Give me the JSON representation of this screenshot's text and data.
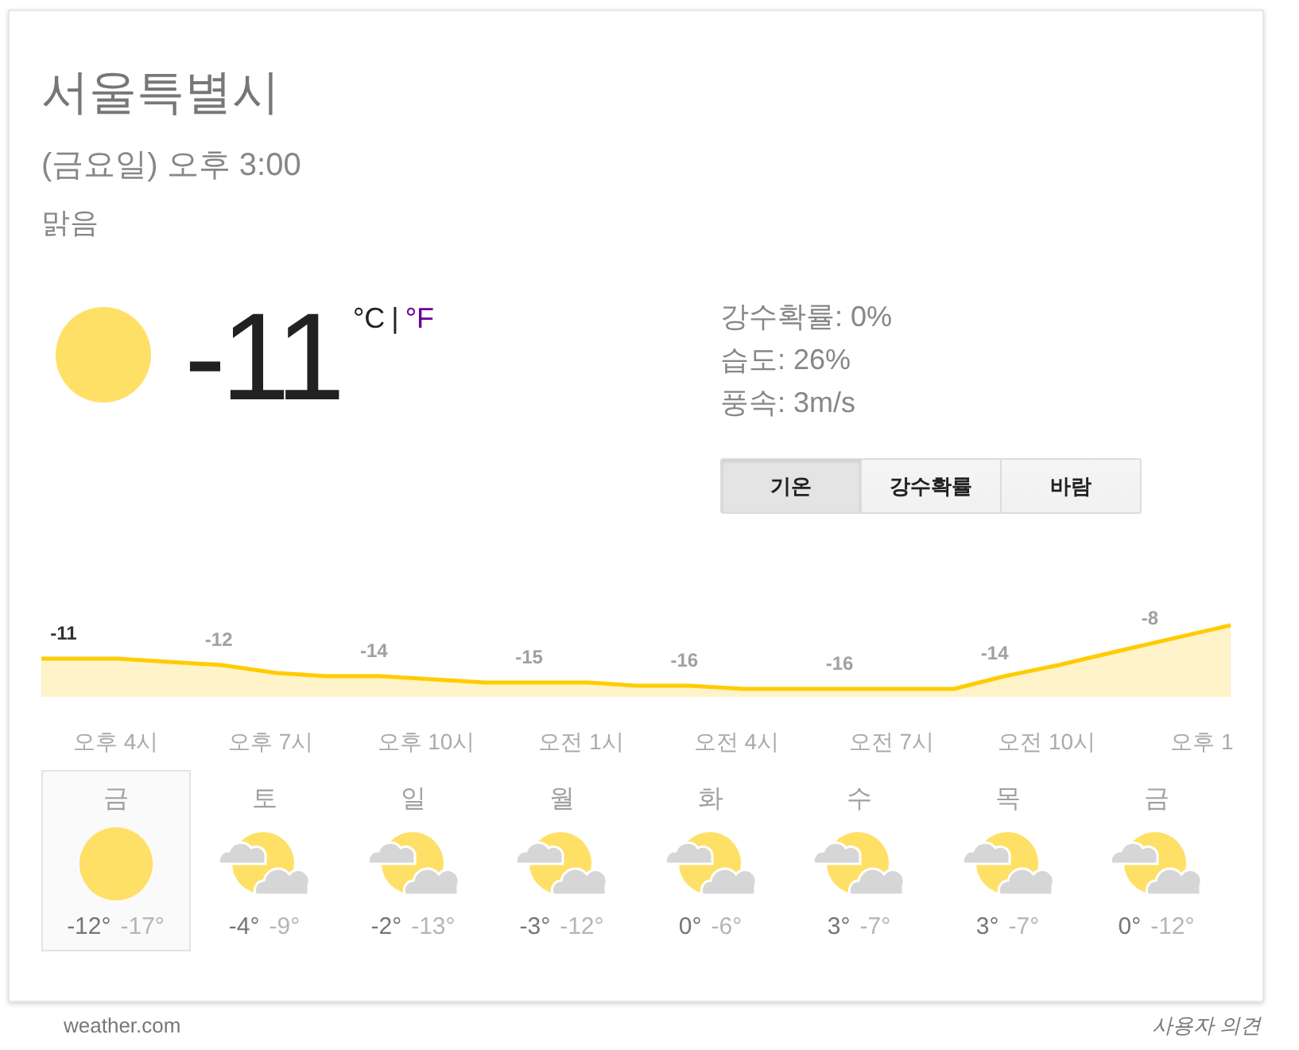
{
  "location": {
    "title": "서울특별시",
    "datetime": "(금요일) 오후 3:00",
    "condition": "맑음"
  },
  "current": {
    "kind": "sunny",
    "temperature": "-11",
    "units": [
      {
        "label": "°C",
        "selected": true
      },
      {
        "label": "°F",
        "selected": false
      }
    ],
    "unit_separator": "|",
    "details": [
      "강수확률: 0%",
      "습도: 26%",
      "풍속: 3m/s"
    ]
  },
  "tabs": [
    {
      "label": "기온",
      "selected": true
    },
    {
      "label": "강수확률",
      "selected": false
    },
    {
      "label": "바람",
      "selected": false
    }
  ],
  "hourly": {
    "first_label_current": true,
    "value_labels": [
      "-11",
      "-12",
      "-14",
      "-15",
      "-16",
      "-16",
      "-14",
      "-8"
    ],
    "hour_labels": [
      "오후 4시",
      "오후 7시",
      "오후 10시",
      "오전 1시",
      "오전 4시",
      "오전 7시",
      "오전 10시",
      "오후 1"
    ]
  },
  "days": [
    {
      "day": "금",
      "kind": "sunny",
      "high": "-12°",
      "low": "-17°",
      "selected": true
    },
    {
      "day": "토",
      "kind": "partly_cloudy",
      "high": "-4°",
      "low": "-9°",
      "selected": false
    },
    {
      "day": "일",
      "kind": "partly_cloudy",
      "high": "-2°",
      "low": "-13°",
      "selected": false
    },
    {
      "day": "월",
      "kind": "partly_cloudy",
      "high": "-3°",
      "low": "-12°",
      "selected": false
    },
    {
      "day": "화",
      "kind": "partly_cloudy",
      "high": "0°",
      "low": "-6°",
      "selected": false
    },
    {
      "day": "수",
      "kind": "partly_cloudy",
      "high": "3°",
      "low": "-7°",
      "selected": false
    },
    {
      "day": "목",
      "kind": "partly_cloudy",
      "high": "3°",
      "low": "-7°",
      "selected": false
    },
    {
      "day": "금",
      "kind": "partly_cloudy",
      "high": "0°",
      "low": "-12°",
      "selected": false
    }
  ],
  "footer": {
    "source": "weather.com",
    "feedback": "사용자 의견"
  }
}
